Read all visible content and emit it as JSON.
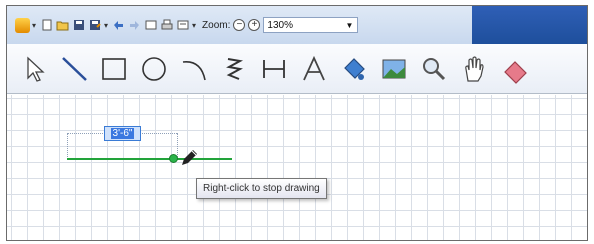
{
  "toolbar_top": {
    "zoom_label": "Zoom:",
    "zoom_value": "130%",
    "icons": [
      "app-icon",
      "new-icon",
      "open-icon",
      "save-icon",
      "save-as-icon",
      "undo-icon",
      "redo-icon",
      "page-setup-icon",
      "print-icon",
      "print-preview-icon"
    ]
  },
  "tools": [
    "select-arrow-icon",
    "line-icon",
    "rectangle-icon",
    "ellipse-icon",
    "arc-icon",
    "freehand-icon",
    "dimension-icon",
    "text-icon",
    "fill-icon",
    "image-icon",
    "zoom-magnifier-icon",
    "pan-hand-icon",
    "eraser-icon"
  ],
  "canvas": {
    "dimension_text": "3'-6\"",
    "tooltip": "Right-click to stop drawing"
  },
  "colors": {
    "title_band": "#1e4f9c",
    "line_green": "#22a33a",
    "dimension_highlight": "#3b78e0"
  }
}
